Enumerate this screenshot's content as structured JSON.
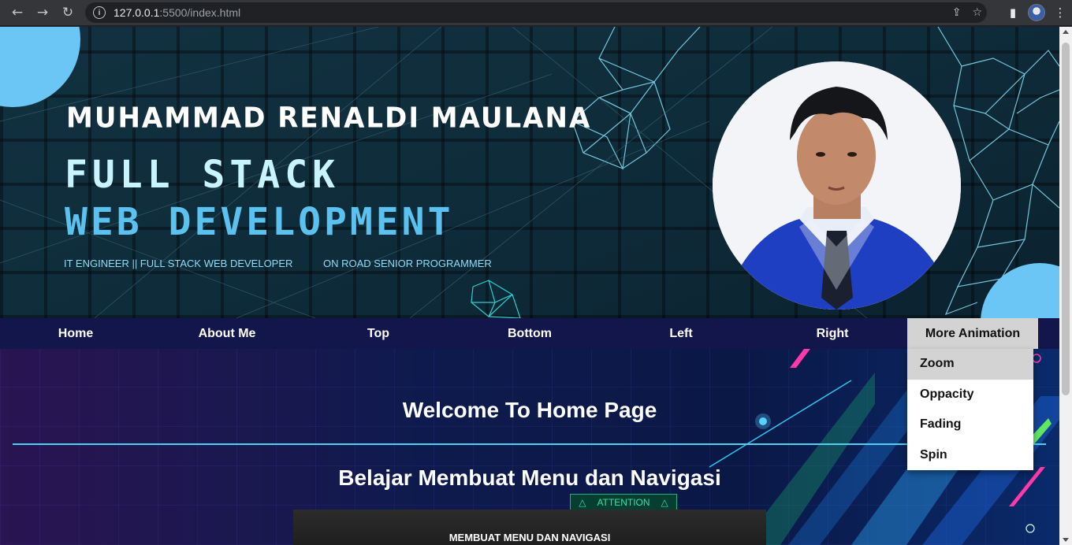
{
  "browser": {
    "url_host": "127.0.0.1",
    "url_rest": ":5500/index.html",
    "back_icon": "←",
    "forward_icon": "→",
    "reload_icon": "↻",
    "info_icon": "i",
    "share_icon": "⇪",
    "star_icon": "☆",
    "sidepanel_icon": "▮",
    "menu_icon": "⋮"
  },
  "hero": {
    "name": "MUHAMMAD RENALDI MAULANA",
    "line1": "FULL STACK",
    "line2": "WEB DEVELOPMENT",
    "tagline1": "IT ENGINEER || FULL STACK WEB DEVELOPER",
    "tagline2": "ON ROAD SENIOR PROGRAMMER"
  },
  "nav": {
    "items": [
      "Home",
      "About Me",
      "Top",
      "Bottom",
      "Left",
      "Right"
    ],
    "more": "More Animation"
  },
  "dropdown": {
    "items": [
      "Zoom",
      "Oppacity",
      "Fading",
      "Spin"
    ]
  },
  "content": {
    "welcome": "Welcome To Home Page",
    "heading": "Belajar Membuat Menu dan Navigasi",
    "attention": "ATTENTION",
    "video_title": "MEMBUAT MENU DAN NAVIGASI"
  },
  "colors": {
    "accent": "#6cc6f5",
    "nav_bg": "#12164a",
    "active_bg": "#d3d3d3"
  }
}
